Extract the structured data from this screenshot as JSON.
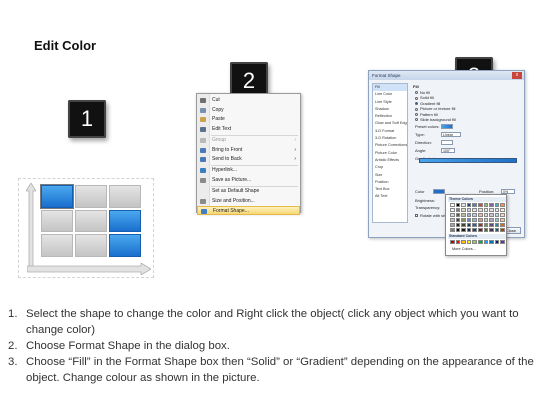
{
  "title": "Edit Color",
  "badges": [
    "1",
    "2",
    "3"
  ],
  "demo": {
    "grid": [
      [
        "blue",
        "grey",
        "grey"
      ],
      [
        "grey",
        "grey",
        "blue"
      ],
      [
        "grey",
        "grey",
        "blue"
      ]
    ]
  },
  "context_menu": {
    "items": [
      {
        "label": "Cut",
        "icon": "scissors-icon",
        "color": "#6f6f6f",
        "disabled": false,
        "submenu": false
      },
      {
        "label": "Copy",
        "icon": "copy-icon",
        "color": "#7a8fb0",
        "disabled": false,
        "submenu": false
      },
      {
        "label": "Paste",
        "icon": "paste-icon",
        "color": "#c9a24a",
        "disabled": false,
        "submenu": false
      },
      {
        "label": "Edit Text",
        "icon": "edit-text-icon",
        "color": "#5d6f8f",
        "disabled": false,
        "submenu": false
      },
      {
        "label": "Group",
        "icon": "group-icon",
        "color": "#b8b8b8",
        "disabled": true,
        "submenu": true
      },
      {
        "label": "Bring to Front",
        "icon": "bring-to-front-icon",
        "color": "#4a78b8",
        "disabled": false,
        "submenu": true
      },
      {
        "label": "Send to Back",
        "icon": "send-to-back-icon",
        "color": "#4a78b8",
        "disabled": false,
        "submenu": true
      },
      {
        "label": "Hyperlink...",
        "icon": "hyperlink-icon",
        "color": "#3c7fc0",
        "disabled": false,
        "submenu": false
      },
      {
        "label": "Save as Picture...",
        "icon": "save-picture-icon",
        "color": "#8a8a8a",
        "disabled": false,
        "submenu": false
      },
      {
        "label": "Set as Default Shape",
        "icon": "none",
        "color": "",
        "disabled": false,
        "submenu": false
      },
      {
        "label": "Size and Position...",
        "icon": "size-position-icon",
        "color": "#8a8a8a",
        "disabled": false,
        "submenu": false
      },
      {
        "label": "Format Shape...",
        "icon": "format-shape-icon",
        "color": "#3f7fc6",
        "disabled": false,
        "submenu": false,
        "highlight": true
      }
    ]
  },
  "dialog": {
    "title": "Format Shape",
    "close": "x",
    "categories": [
      "Fill",
      "Line Color",
      "Line Style",
      "Shadow",
      "Reflection",
      "Glow and Soft Edges",
      "3-D Format",
      "3-D Rotation",
      "Picture Corrections",
      "Picture Color",
      "Artistic Effects",
      "Crop",
      "Size",
      "Position",
      "Text Box",
      "Alt Text"
    ],
    "fill_heading": "Fill",
    "fill_options": [
      {
        "label": "No fill",
        "on": false
      },
      {
        "label": "Solid fill",
        "on": false
      },
      {
        "label": "Gradient fill",
        "on": true
      },
      {
        "label": "Picture or texture fill",
        "on": false
      },
      {
        "label": "Pattern fill",
        "on": false
      },
      {
        "label": "Slide background fill",
        "on": false
      }
    ],
    "preset_colors": "Preset colors:",
    "type_label": "Type:",
    "type_value": "Linear",
    "direction_label": "Direction:",
    "angle_label": "Angle:",
    "angle_value": "100°",
    "gradient_stops": "Gradient stops",
    "color_label": "Color",
    "position_label": "Position:",
    "position_value": "0%",
    "brightness_label": "Brightness:",
    "transparency_label": "Transparency:",
    "rotate_label": "Rotate with shape",
    "close_btn": "Close"
  },
  "color_popup": {
    "theme_colors": "Theme Colors",
    "standard_colors": "Standard Colors",
    "more_colors": "More Colors...",
    "theme_rows": [
      [
        "#ffffff",
        "#000000",
        "#eeece1",
        "#1f497d",
        "#4f81bd",
        "#c0504d",
        "#9bbb59",
        "#8064a2",
        "#4bacc6",
        "#f79646"
      ],
      [
        "#f2f2f2",
        "#7f7f7f",
        "#ddd9c3",
        "#c6d9f0",
        "#dbe5f1",
        "#f2dcdb",
        "#ebf1dd",
        "#e5e0ec",
        "#dbeef3",
        "#fdeada"
      ],
      [
        "#d8d8d8",
        "#595959",
        "#c4bd97",
        "#8db3e2",
        "#b8cce4",
        "#e5b9b7",
        "#d7e3bc",
        "#ccc1d9",
        "#b7dde8",
        "#fbd5b5"
      ],
      [
        "#bfbfbf",
        "#3f3f3f",
        "#938953",
        "#548dd4",
        "#95b3d7",
        "#d99694",
        "#c3d69b",
        "#b2a2c7",
        "#92cddc",
        "#fac08f"
      ],
      [
        "#a5a5a5",
        "#262626",
        "#494429",
        "#17365d",
        "#366092",
        "#953734",
        "#76923c",
        "#5f497a",
        "#31859b",
        "#e36c09"
      ],
      [
        "#7f7f7f",
        "#0c0c0c",
        "#1d1b10",
        "#0f243e",
        "#244061",
        "#632423",
        "#4f6128",
        "#3f3151",
        "#205867",
        "#974806"
      ]
    ],
    "standard_row": [
      "#c00000",
      "#ff0000",
      "#ffc000",
      "#ffff00",
      "#92d050",
      "#00b050",
      "#00b0f0",
      "#0070c0",
      "#002060",
      "#7030a0"
    ]
  },
  "instructions": [
    {
      "num": "1.",
      "text": "Select the shape to change the color and Right click the object( click any object which you want to change color)"
    },
    {
      "num": "2.",
      "text": "Choose Format Shape in the dialog box."
    },
    {
      "num": "3.",
      "text": "Choose “Fill” in the Format Shape box then “Solid” or “Gradient” depending on the appearance of the object. Change colour as shown in the picture."
    }
  ]
}
